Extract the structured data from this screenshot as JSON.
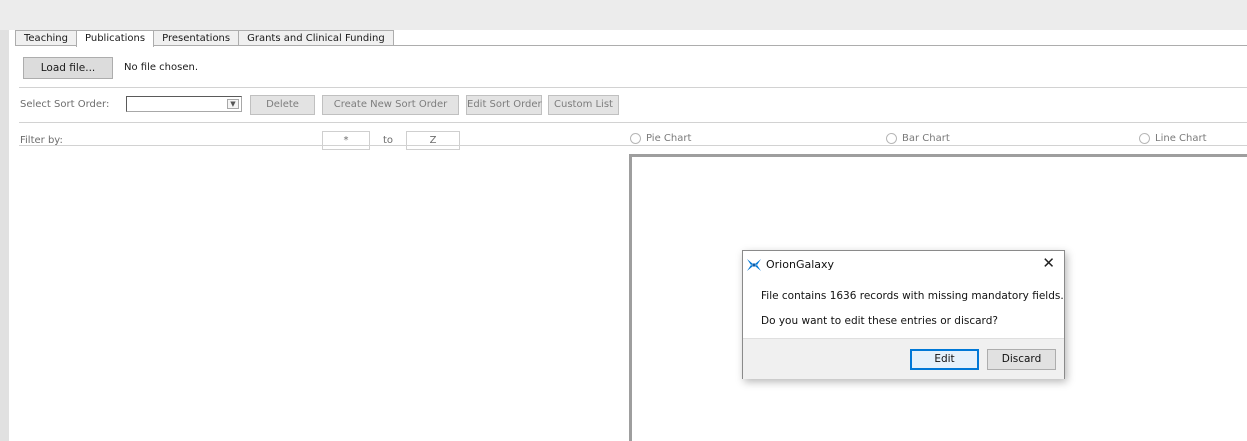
{
  "tabs": [
    {
      "label": "Teaching",
      "active": false
    },
    {
      "label": "Publications",
      "active": true
    },
    {
      "label": "Presentations",
      "active": false
    },
    {
      "label": "Grants and Clinical Funding",
      "active": false
    }
  ],
  "load_row": {
    "load_button": "Load file...",
    "file_status": "No file chosen."
  },
  "sort_row": {
    "label": "Select Sort Order:",
    "selected_value": "",
    "dropdown_arrow": "▼",
    "delete_button": "Delete",
    "create_button": "Create New Sort Order",
    "edit_button": "Edit Sort Order",
    "custom_list_button": "Custom List"
  },
  "filter_row": {
    "label": "Filter by:",
    "from_value": "*",
    "to_label": "to",
    "to_value": "Z"
  },
  "chart_options": {
    "pie": "Pie Chart",
    "bar": "Bar Chart",
    "line": "Line Chart"
  },
  "dialog": {
    "title": "OrionGalaxy",
    "close_glyph": "✕",
    "message_line1": "File contains 1636 records with missing mandatory fields.",
    "message_line2": "Do you want to edit these entries or discard?",
    "edit_button": "Edit",
    "discard_button": "Discard",
    "icon": "orion-galaxy-logo-icon",
    "accent_color": "#0078d7"
  }
}
